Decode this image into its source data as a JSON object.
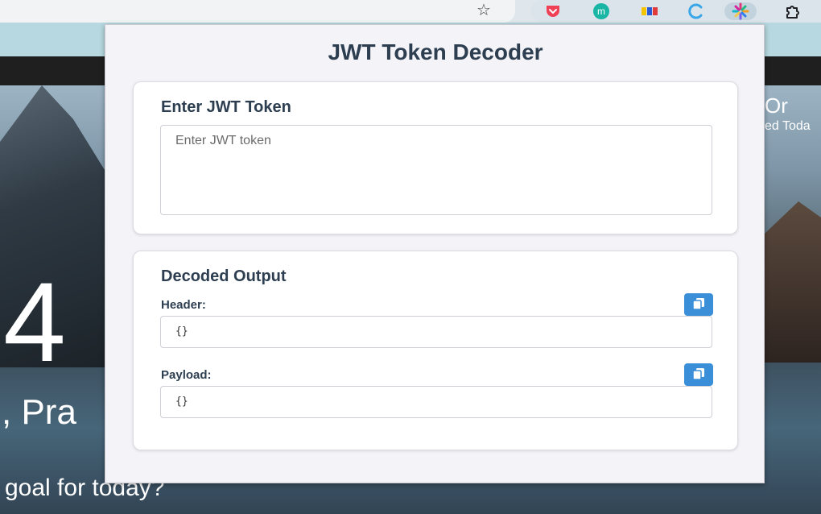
{
  "popup": {
    "title": "JWT Token Decoder",
    "input_section": {
      "heading": "Enter JWT Token",
      "placeholder": "Enter JWT token",
      "value": ""
    },
    "output_section": {
      "heading": "Decoded Output",
      "header_label": "Header:",
      "header_value": "{}",
      "payload_label": "Payload:",
      "payload_value": "{}",
      "copy_icon": "copy-icon"
    }
  },
  "background_page": {
    "big_text": "4",
    "greeting_fragment": ", Pra",
    "goal_prompt_fragment": "goal for today?",
    "right_text_1": "Or",
    "right_text_2": "ed Toda"
  },
  "browser": {
    "extension_icons": [
      "pocket-icon",
      "m-extension-icon",
      "flag-extension-icon",
      "c-extension-icon",
      "jwt-decoder-extension-icon",
      "puzzle-extensions-icon"
    ]
  },
  "colors": {
    "accent": "#3b8fd9",
    "heading": "#2c3e50",
    "popup_bg": "#f4f3f8",
    "card_bg": "#ffffff"
  }
}
